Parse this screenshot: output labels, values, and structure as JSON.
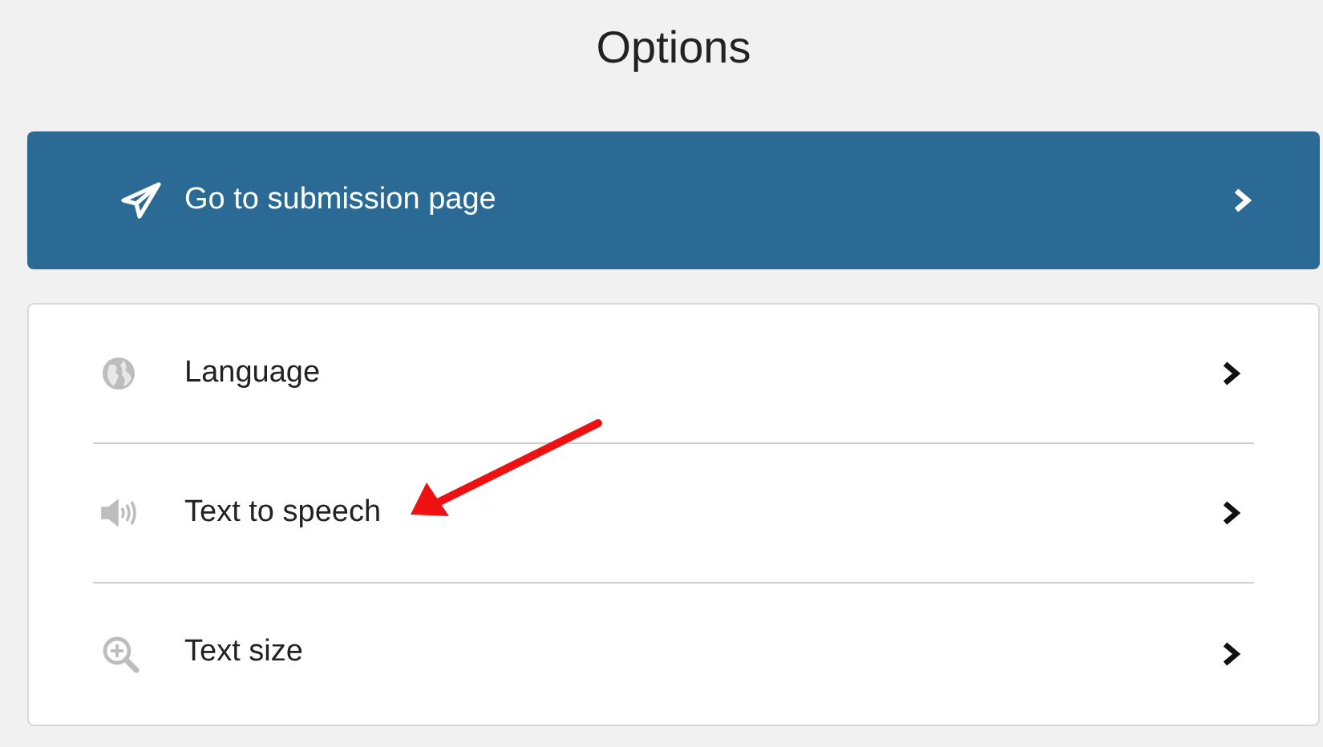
{
  "header": {
    "title": "Options"
  },
  "primary_action": {
    "label": "Go to submission page",
    "kind": "submit"
  },
  "menu": [
    {
      "label": "Language",
      "kind": "language"
    },
    {
      "label": "Text to speech",
      "kind": "speech"
    },
    {
      "label": "Text size",
      "kind": "size"
    }
  ],
  "annotation": {
    "kind": "arrow"
  }
}
